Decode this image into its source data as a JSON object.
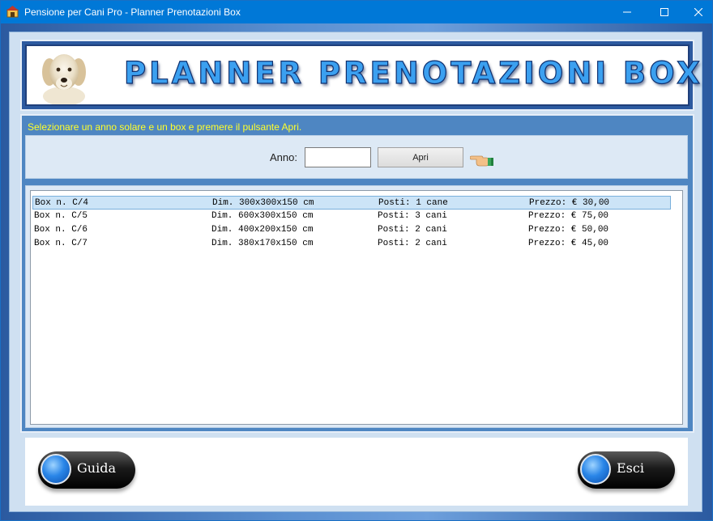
{
  "window": {
    "title": "Pensione per Cani Pro - Planner Prenotazioni Box"
  },
  "banner": {
    "title": "PLANNER PRENOTAZIONI BOX"
  },
  "instruction": "Selezionare un anno solare e un box e premere il pulsante Apri.",
  "form": {
    "anno_label": "Anno:",
    "anno_value": "",
    "apri_label": "Apri"
  },
  "box_list": [
    {
      "box": "Box n. C/4",
      "dim": "Dim. 300x300x150 cm",
      "posti": "Posti: 1 cane",
      "prezzo": "Prezzo: € 30,00",
      "selected": true
    },
    {
      "box": "Box n. C/5",
      "dim": "Dim. 600x300x150 cm",
      "posti": "Posti: 3 cani",
      "prezzo": "Prezzo: € 75,00",
      "selected": false
    },
    {
      "box": "Box n. C/6",
      "dim": "Dim. 400x200x150 cm",
      "posti": "Posti: 2 cani",
      "prezzo": "Prezzo: € 50,00",
      "selected": false
    },
    {
      "box": "Box n. C/7",
      "dim": "Dim. 380x170x150 cm",
      "posti": "Posti: 2 cani",
      "prezzo": "Prezzo: € 45,00",
      "selected": false
    }
  ],
  "buttons": {
    "guida": "Guida",
    "esci": "Esci"
  },
  "colors": {
    "titlebar": "#0078d7",
    "instruction_text": "#ffff2a",
    "selected_row": "#cce4f7",
    "panel_blue": "#4e86c2"
  },
  "icons": {
    "app": "dog-house-icon",
    "banner": "dog-photo",
    "pointer": "pointing-hand-icon"
  }
}
